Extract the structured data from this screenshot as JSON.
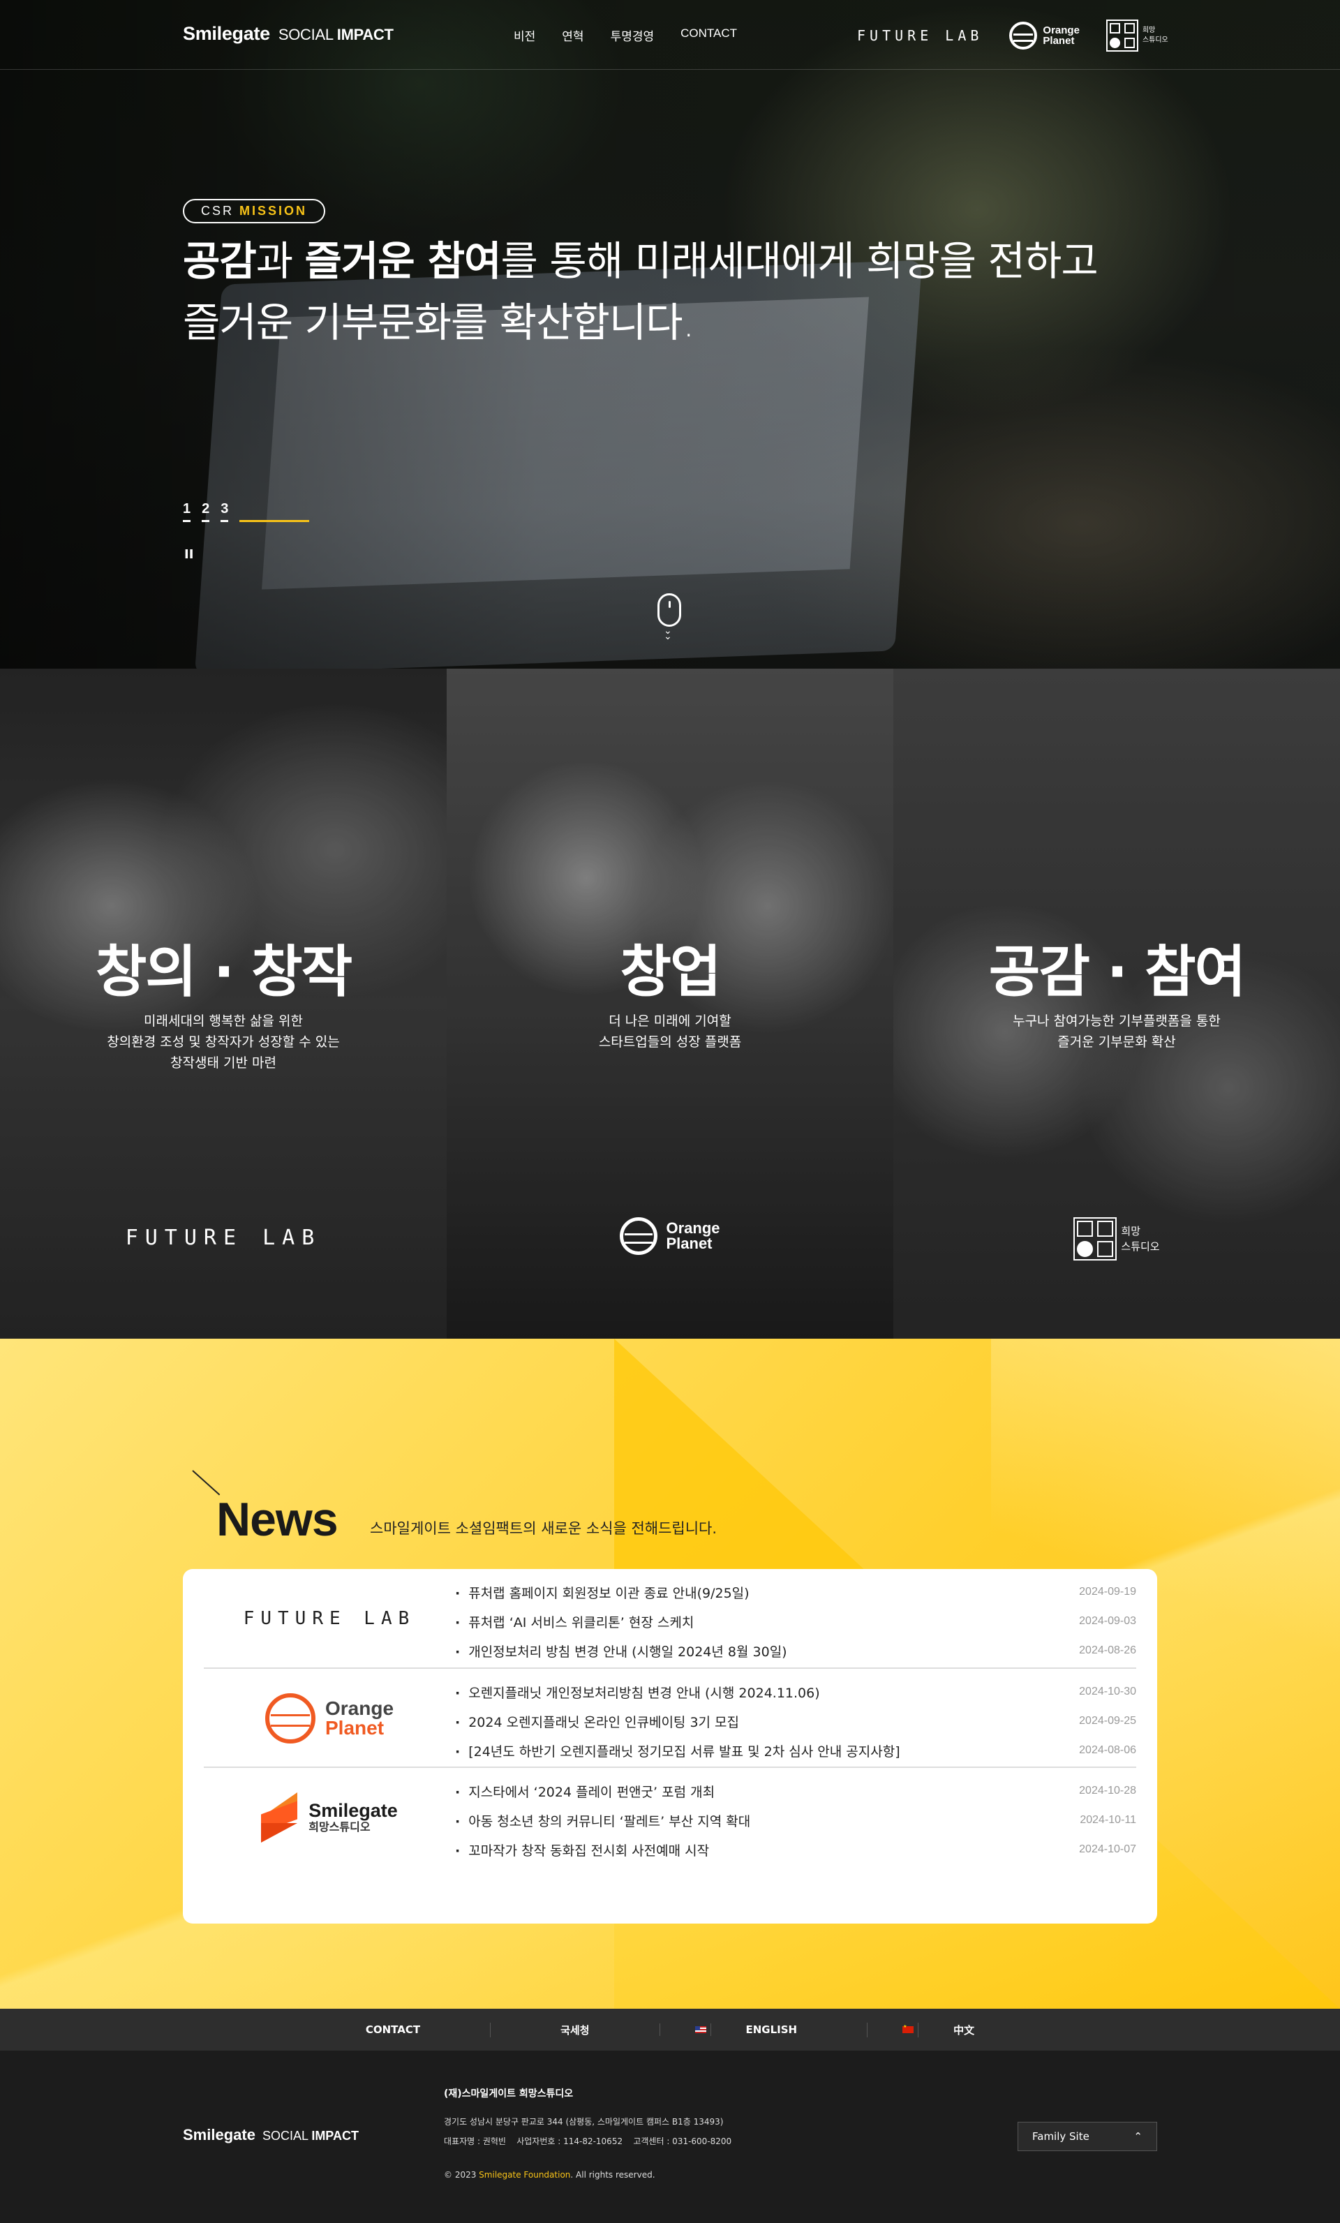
{
  "header": {
    "logo_main": "Smilegate",
    "logo_sub_light": "SOCIAL",
    "logo_sub_bold": "IMPACT",
    "menu": [
      "비전",
      "연혁",
      "투명경영",
      "CONTACT"
    ],
    "brands": {
      "future_lab": "FUTURE LAB",
      "orange_planet_1": "Orange",
      "orange_planet_2": "Planet",
      "hope_studio_1": "희망",
      "hope_studio_2": "스튜디오"
    }
  },
  "hero": {
    "badge_light": "CSR",
    "badge_bold": "MISSION",
    "title_b1": "공감",
    "title_t1": "과 ",
    "title_b2": "즐거운 참여",
    "title_t2": "를 통해 미래세대에게 희망을 전하고",
    "title_line2": "즐거운 기부문화를 확산합니다.",
    "pages": [
      "1",
      "2",
      "3"
    ],
    "pause_label": "II"
  },
  "panels": [
    {
      "title": "창의 · 창작",
      "desc1": "미래세대의 행복한 삶을 위한",
      "desc2": "창의환경 조성 및 창작자가 성장할 수 있는",
      "desc3": "창작생태 기반 마련",
      "brand": "FUTURE LAB"
    },
    {
      "title": "창업",
      "desc1": "더 나은 미래에 기여할",
      "desc2": "스타트업들의 성장 플랫폼",
      "desc3": "",
      "brand1": "Orange",
      "brand2": "Planet"
    },
    {
      "title": "공감 · 참여",
      "desc1": "누구나 참여가능한 기부플랫폼을 통한",
      "desc2": "즐거운 기부문화 확산",
      "desc3": "",
      "brand1": "희망",
      "brand2": "스튜디오"
    }
  ],
  "news": {
    "title": "News",
    "subtitle": "스마일게이트 소셜임팩트의 새로운 소식을 전해드립니다.",
    "groups": [
      {
        "brand": "FUTURE LAB",
        "items": [
          {
            "title": "퓨처랩 홈페이지 회원정보 이관 종료 안내(9/25일)",
            "date": "2024-09-19"
          },
          {
            "title": "퓨처랩 ‘AI 서비스 위클리톤’ 현장 스케치",
            "date": "2024-09-03"
          },
          {
            "title": "개인정보처리 방침 변경 안내 (시행일 2024년 8월 30일)",
            "date": "2024-08-26"
          }
        ]
      },
      {
        "brand1": "Orange",
        "brand2": "Planet",
        "items": [
          {
            "title": "오렌지플래닛 개인정보처리방침 변경 안내 (시행 2024.11.06)",
            "date": "2024-10-30"
          },
          {
            "title": "2024 오렌지플래닛 온라인 인큐베이팅 3기 모집",
            "date": "2024-09-25"
          },
          {
            "title": "[24년도 하반기 오렌지플래닛 정기모집 서류 발표 및 2차 심사 안내 공지사항]",
            "date": "2024-08-06"
          }
        ]
      },
      {
        "brand1": "Smilegate",
        "brand2": "희망스튜디오",
        "items": [
          {
            "title": "지스타에서 ‘2024 플레이 펀앤굿’ 포럼 개최",
            "date": "2024-10-28"
          },
          {
            "title": "아동 청소년 창의 커뮤니티 ‘팔레트’ 부산 지역 확대",
            "date": "2024-10-11"
          },
          {
            "title": "꼬마작가 창작 동화집 전시회 사전예매 시작",
            "date": "2024-10-07"
          }
        ]
      }
    ]
  },
  "footer_links": [
    "CONTACT",
    "국세청",
    "ENGLISH",
    "中文"
  ],
  "footer": {
    "logo_main": "Smilegate",
    "logo_sub_light": "SOCIAL",
    "logo_sub_bold": "IMPACT",
    "org": "(재)스마일게이트 희망스튜디오",
    "address": "경기도 성남시 분당구 판교로 344 (삼평동, 스마일게이트 캠퍼스 B1층 13493)",
    "info": "대표자명 : 권혁빈    사업자번호 : 114-82-10652    고객센터 : 031-600-8200",
    "copy_pre": "© 2023 ",
    "copy_brand": "Smilegate Foundation",
    "copy_post": ". All rights reserved.",
    "family_site": "Family Site"
  },
  "colors": {
    "accent": "#f8c318",
    "orange": "#f05a22",
    "news_bg": "#ffd23a",
    "footer": "#1c1c1c"
  }
}
